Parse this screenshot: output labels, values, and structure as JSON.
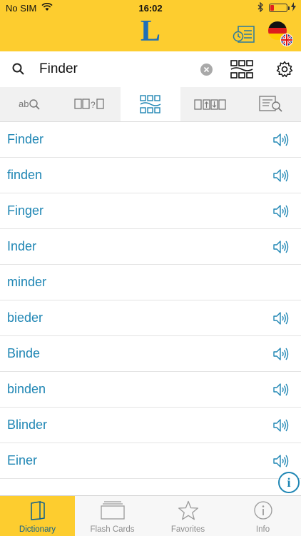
{
  "status_bar": {
    "carrier": "No SIM",
    "time": "16:02"
  },
  "header": {
    "logo_letter": "L"
  },
  "search": {
    "query": "Finder",
    "placeholder": ""
  },
  "modes": [
    {
      "icon": "ab-search-icon",
      "active": false
    },
    {
      "icon": "word-quiz-icon",
      "active": false
    },
    {
      "icon": "word-grid-icon",
      "active": true
    },
    {
      "icon": "flashcard-transfer-icon",
      "active": false
    },
    {
      "icon": "text-search-icon",
      "active": false
    }
  ],
  "results": [
    {
      "word": "Finder",
      "audio": true
    },
    {
      "word": "finden",
      "audio": true
    },
    {
      "word": "Finger",
      "audio": true
    },
    {
      "word": "Inder",
      "audio": true
    },
    {
      "word": "minder",
      "audio": false
    },
    {
      "word": "bieder",
      "audio": true
    },
    {
      "word": "Binde",
      "audio": true
    },
    {
      "word": "binden",
      "audio": true
    },
    {
      "word": "Blinder",
      "audio": true
    },
    {
      "word": "Einer",
      "audio": true
    }
  ],
  "info_fab": "i",
  "tabs": [
    {
      "label": "Dictionary",
      "icon": "book-icon",
      "active": true
    },
    {
      "label": "Flash Cards",
      "icon": "flash-cards-icon",
      "active": false
    },
    {
      "label": "Favorites",
      "icon": "star-icon",
      "active": false
    },
    {
      "label": "Info",
      "icon": "info-icon",
      "active": false
    }
  ],
  "colors": {
    "accent_yellow": "#fdcd2f",
    "link_blue": "#1f86b4",
    "logo_blue": "#1f6fb8"
  }
}
